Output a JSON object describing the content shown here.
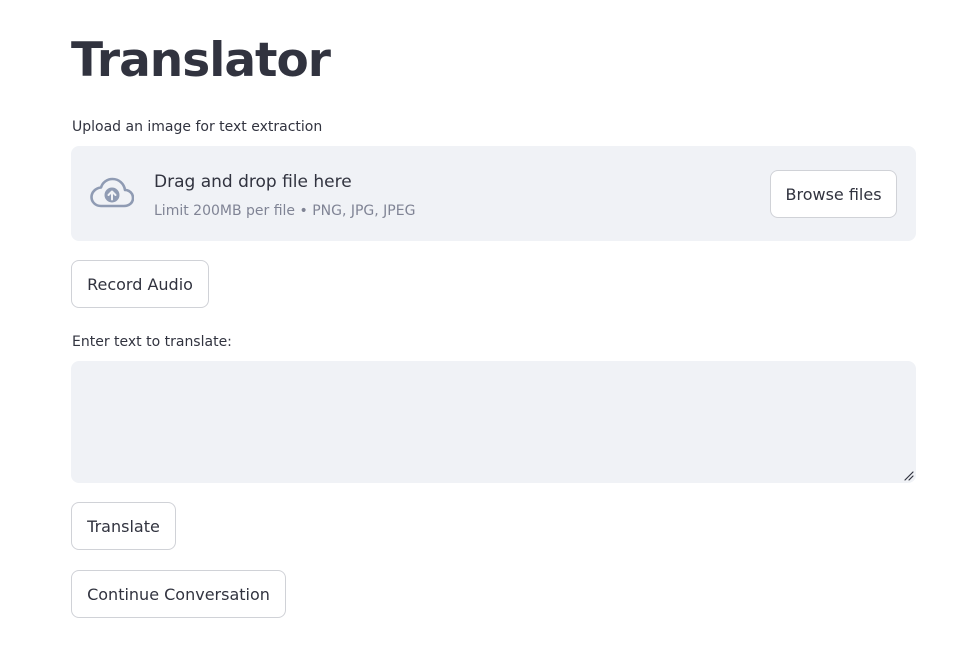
{
  "page": {
    "title": "Translator"
  },
  "uploader": {
    "label": "Upload an image for text extraction",
    "icon": "cloud-upload-icon",
    "drop_text": "Drag and drop file here",
    "hint": "Limit 200MB per file • PNG, JPG, JPEG",
    "browse_label": "Browse files"
  },
  "audio": {
    "record_label": "Record Audio"
  },
  "text_input": {
    "label": "Enter text to translate:",
    "value": ""
  },
  "actions": {
    "translate_label": "Translate",
    "continue_label": "Continue Conversation"
  },
  "colors": {
    "text": "#31333f",
    "muted": "#808495",
    "surface": "#f0f2f6",
    "border": "#d0d2d7",
    "icon": "#8f9bb3"
  }
}
